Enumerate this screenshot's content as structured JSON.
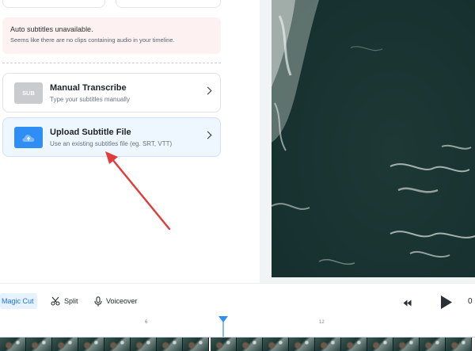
{
  "warning": {
    "title": "Auto subtitles unavailable.",
    "message": "Seems like there are no clips containing audio in your timeline."
  },
  "options": [
    {
      "badge": "SUB",
      "title": "Manual Transcribe",
      "subtitle": "Type your subtitles manually"
    },
    {
      "title": "Upload Subtitle File",
      "subtitle": "Use an existing subtitles file (eg. SRT, VTT)"
    }
  ],
  "toolbar": {
    "magic_cut": "Magic Cut",
    "split": "Split",
    "voiceover": "Voiceover",
    "time_prefix": "0"
  },
  "timeline": {
    "tick_a": "6",
    "tick_b": "12"
  },
  "colors": {
    "accent": "#2f8ef4",
    "annotation_arrow": "#e23b3b",
    "warning_bg": "#fdf2f1"
  }
}
